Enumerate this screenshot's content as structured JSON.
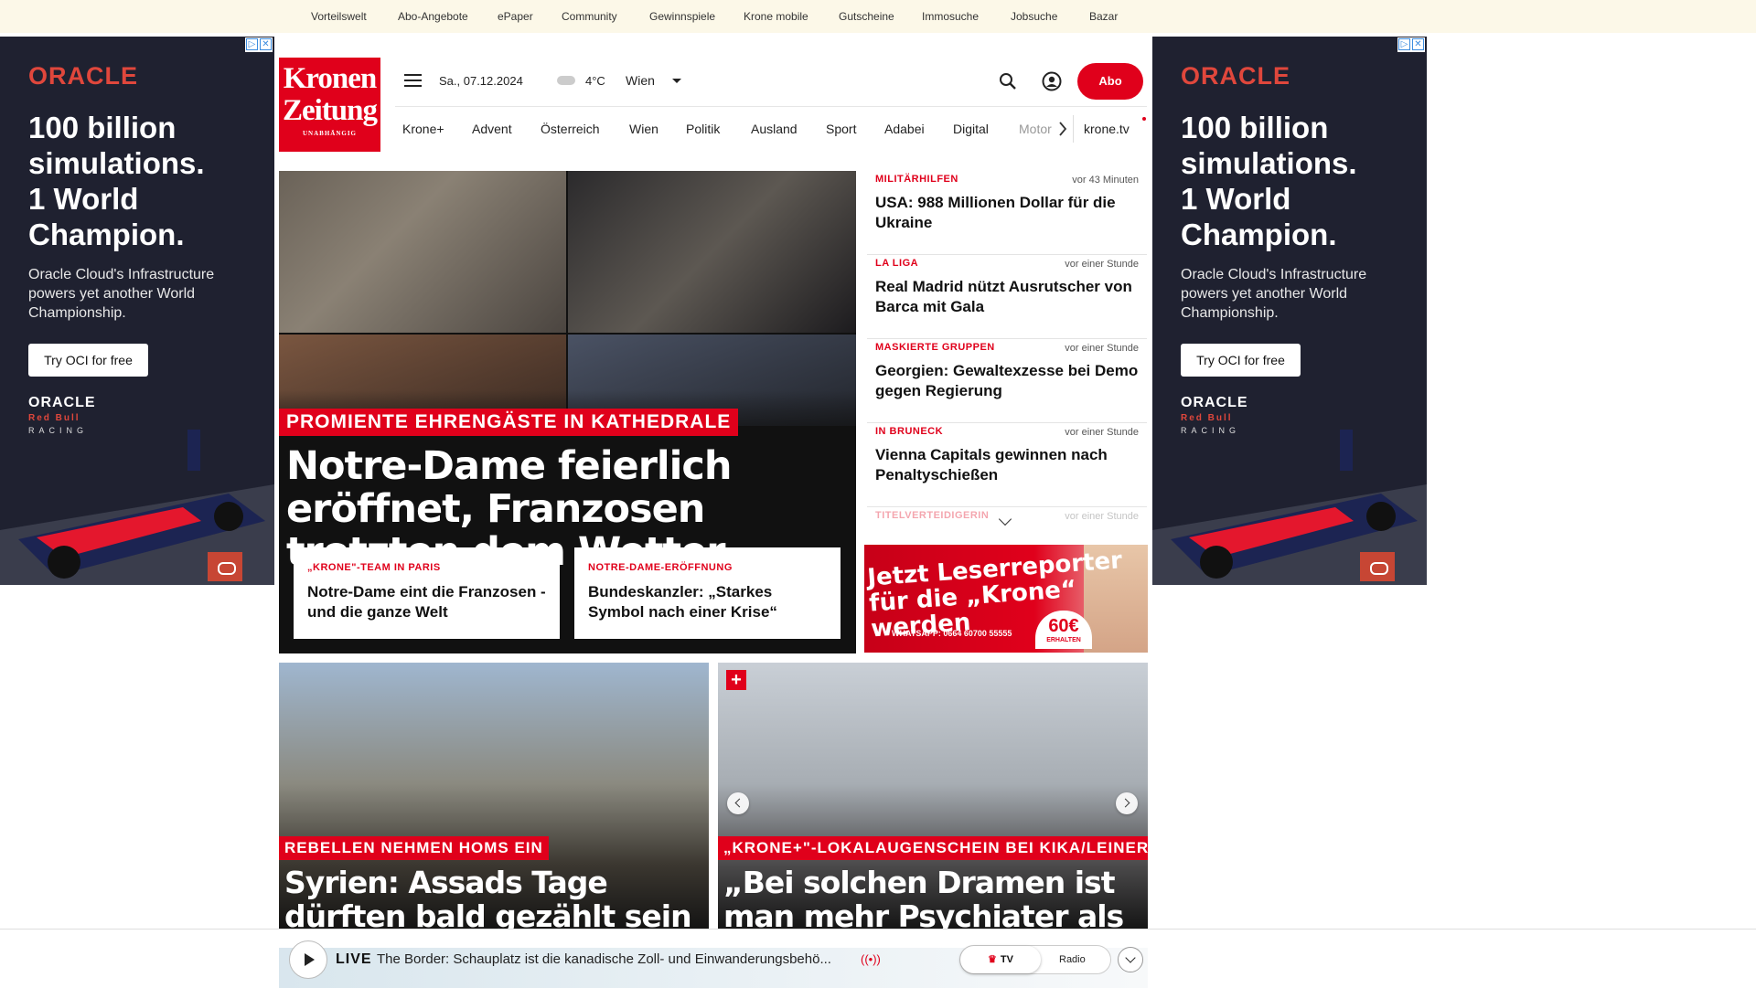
{
  "topbar": {
    "links": [
      "Vorteilswelt",
      "Abo-Angebote",
      "ePaper",
      "Community",
      "Gewinnspiele",
      "Krone mobile",
      "Gutscheine",
      "Immosuche",
      "Jobsuche",
      "Bazar"
    ]
  },
  "ad": {
    "brand": "ORACLE",
    "headline_1": "100 billion",
    "headline_2": "simulations.",
    "headline_3": "1 World",
    "headline_4": "Champion.",
    "sub": "Oracle Cloud's Infrastructure powers yet another World Championship.",
    "cta": "Try OCI for free",
    "logo_brand": "ORACLE",
    "logo_partner": "Red Bull",
    "logo_racing": "RACING"
  },
  "header": {
    "logo_line1": "Kronen",
    "logo_line2": "Zeitung",
    "logo_tagline": "UNABHÄNGIG",
    "date": "Sa., 07.12.2024",
    "temperature": "4°C",
    "city": "Wien",
    "abo_label": "Abo"
  },
  "nav": {
    "items": [
      "Krone+",
      "Advent",
      "Österreich",
      "Wien",
      "Politik",
      "Ausland",
      "Sport",
      "Adabei",
      "Digital",
      "Motor"
    ],
    "tv": "krone.tv"
  },
  "hero": {
    "kicker": "PROMIENTE EHRENGÄSTE IN KATHEDRALE",
    "title": "Notre-Dame feierlich eröffnet, Franzosen trotzten dem Wetter",
    "sub": [
      {
        "kicker": "„KRONE\"-TEAM IN PARIS",
        "title": "Notre-Dame eint die Franzosen - und die ganze Welt"
      },
      {
        "kicker": "NOTRE-DAME-ERÖFFNUNG",
        "title": "Bundeskanzler: „Starkes Symbol nach einer Krise“"
      }
    ]
  },
  "news": [
    {
      "kicker": "MILITÄRHILFEN",
      "time": "vor 43 Minuten",
      "title": "USA: 988 Millionen Dollar für die Ukraine"
    },
    {
      "kicker": "LA LIGA",
      "time": "vor einer Stunde",
      "title": "Real Madrid nützt Ausrutscher von Barca mit Gala"
    },
    {
      "kicker": "MASKIERTE GRUPPEN",
      "time": "vor einer Stunde",
      "title": "Georgien: Gewaltexzesse bei Demo gegen Regierung"
    },
    {
      "kicker": "IN BRUNECK",
      "time": "vor einer Stunde",
      "title": "Vienna Capitals gewinnen nach Penaltyschießen"
    },
    {
      "kicker": "TITELVERTEIDIGERIN",
      "time": "vor einer Stunde",
      "title": ""
    }
  ],
  "banner": {
    "line1": "Jetzt Leserreporter",
    "line2": "für die „Krone“ werden",
    "whatsapp": "WHATSAPP: 0664 60700 55555",
    "amount": "60€",
    "amount_label": "ERHALTEN"
  },
  "stories": [
    {
      "kicker": "REBELLEN NEHMEN HOMS EIN",
      "title": "Syrien: Assads Tage dürften bald gezählt sein"
    },
    {
      "kicker": "„KRONE+\"-LOKALAUGENSCHEIN BEI KIKA/LEINER",
      "title": "„Bei solchen Dramen ist man mehr Psychiater als Verkäufer“"
    }
  ],
  "player": {
    "live": "LIVE",
    "title": "The Border: Schauplatz ist die kanadische Zoll- und Einwanderungsbehö...",
    "tv": "TV",
    "radio": "Radio"
  },
  "colors": {
    "brand_red": "#e0001b",
    "topbar_bg": "#fcf8e8"
  }
}
